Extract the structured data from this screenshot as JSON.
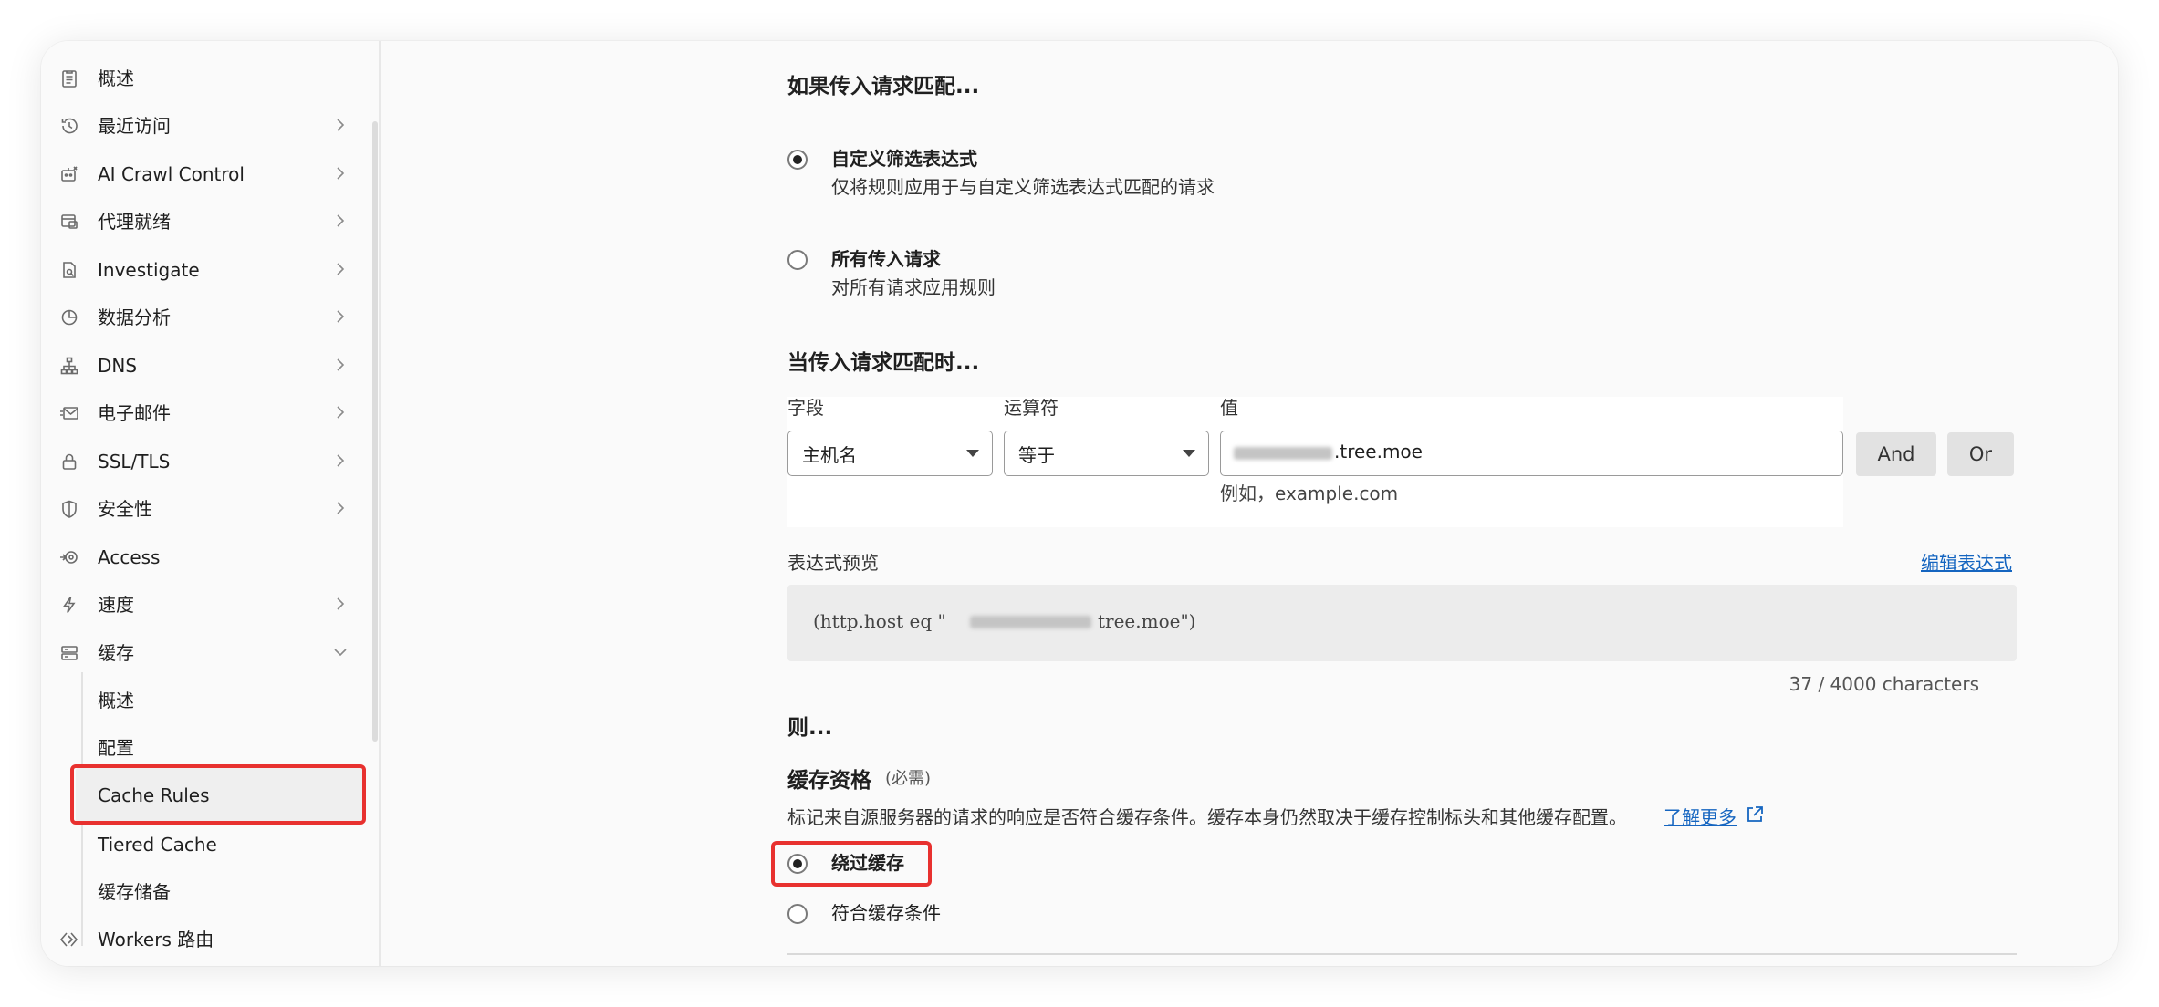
{
  "sidebar": {
    "items": [
      {
        "label": "概述",
        "icon": "clipboard-icon",
        "chevron": false
      },
      {
        "label": "最近访问",
        "icon": "history-icon",
        "chevron": true
      },
      {
        "label": "AI Crawl Control",
        "icon": "robot-icon",
        "chevron": true
      },
      {
        "label": "代理就绪",
        "icon": "proxy-icon",
        "chevron": true
      },
      {
        "label": "Investigate",
        "icon": "document-search-icon",
        "chevron": true
      },
      {
        "label": "数据分析",
        "icon": "pie-chart-icon",
        "chevron": true
      },
      {
        "label": "DNS",
        "icon": "network-icon",
        "chevron": true
      },
      {
        "label": "电子邮件",
        "icon": "email-icon",
        "chevron": true
      },
      {
        "label": "SSL/TLS",
        "icon": "lock-icon",
        "chevron": true
      },
      {
        "label": "安全性",
        "icon": "shield-icon",
        "chevron": true
      },
      {
        "label": "Access",
        "icon": "access-icon",
        "chevron": false
      },
      {
        "label": "速度",
        "icon": "lightning-icon",
        "chevron": true
      },
      {
        "label": "缓存",
        "icon": "storage-icon",
        "chevron": true,
        "expanded": true
      }
    ],
    "cache_sub": [
      {
        "label": "概述"
      },
      {
        "label": "配置"
      },
      {
        "label": "Cache Rules",
        "active": true
      },
      {
        "label": "Tiered Cache"
      },
      {
        "label": "缓存储备"
      }
    ],
    "workers": {
      "label": "Workers 路由",
      "icon": "workers-icon"
    }
  },
  "main": {
    "match_heading": "如果传入请求匹配...",
    "option_custom": {
      "title": "自定义筛选表达式",
      "desc": "仅将规则应用于与自定义筛选表达式匹配的请求",
      "selected": true
    },
    "option_all": {
      "title": "所有传入请求",
      "desc": "对所有请求应用规则",
      "selected": false
    },
    "when_heading": "当传入请求匹配时...",
    "field_label": "字段",
    "operator_label": "运算符",
    "value_label": "值",
    "field_value": "主机名",
    "operator_value": "等于",
    "value_suffix": ".tree.moe",
    "value_hint": "例如，example.com",
    "and_button": "And",
    "or_button": "Or",
    "preview_label": "表达式预览",
    "edit_expression": "编辑表达式",
    "preview_code_prefix": "(http.host eq \"",
    "preview_code_suffix": "tree.moe\")",
    "char_count": "37 / 4000 characters",
    "then_heading": "则...",
    "cache_eligibility": "缓存资格",
    "required_label": "(必需)",
    "cache_desc": "标记来自源服务器的请求的响应是否符合缓存条件。缓存本身仍然取决于缓存控制标头和其他缓存配置。",
    "learn_more": "了解更多",
    "bypass_cache": {
      "label": "绕过缓存",
      "selected": true
    },
    "eligible_cache": {
      "label": "符合缓存条件",
      "selected": false
    }
  },
  "colors": {
    "highlight": "#e8312f",
    "link": "#1565c0",
    "background": "#fafafa"
  }
}
